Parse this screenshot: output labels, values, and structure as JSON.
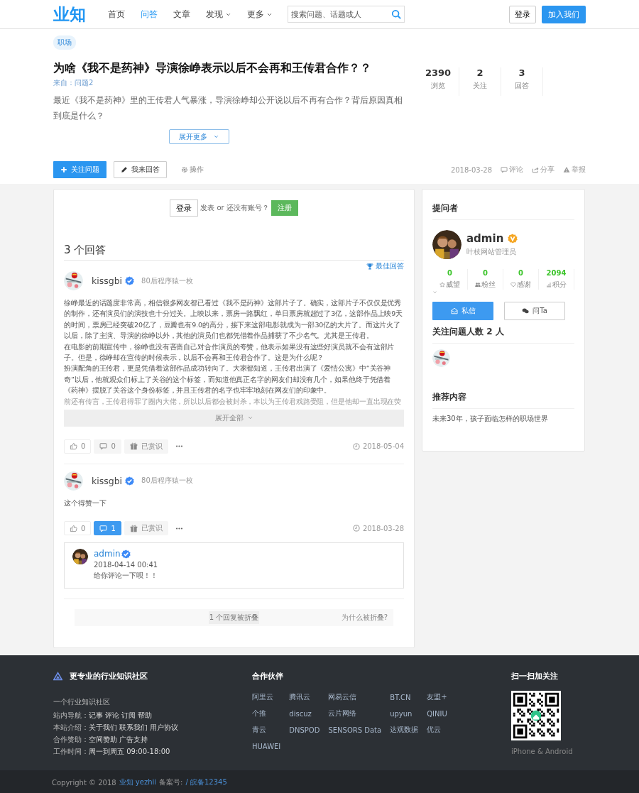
{
  "header": {
    "logo": "业知",
    "nav": [
      {
        "label": "首页",
        "selected": false,
        "dropdown": false
      },
      {
        "label": "问答",
        "selected": true,
        "dropdown": false
      },
      {
        "label": "文章",
        "selected": false,
        "dropdown": false
      },
      {
        "label": "发现",
        "selected": false,
        "dropdown": true
      },
      {
        "label": "更多",
        "selected": false,
        "dropdown": true
      }
    ],
    "search": {
      "placeholder": "搜索问题、话题或人"
    },
    "login": "登录",
    "join": "加入我们"
  },
  "question": {
    "tag": "职场",
    "title": "为啥《我不是药神》导演徐峥表示以后不会再和王传君合作？？",
    "source": "来自：问题2",
    "description": "最近《我不是药神》里的王传君人气暴涨，导演徐峥却公开说以后不再有合作？背后原因真相到底是什么？",
    "expand": "展开更多",
    "stats": [
      {
        "value": "2390",
        "label": "浏览"
      },
      {
        "value": "2",
        "label": "关注"
      },
      {
        "value": "3",
        "label": "回答"
      }
    ],
    "follow_button": "关注问题",
    "answer_button": "我来回答",
    "operate": "操作",
    "date": "2018-03-28",
    "comment": "评论",
    "share": "分享",
    "report": "举报"
  },
  "main": {
    "login_prompt": {
      "login": "登录",
      "text": "发表 or 还没有账号？",
      "register": "注册"
    },
    "answers_title": "3 个回答",
    "best_label": "最佳回答",
    "answers": [
      {
        "author": "kissgbi",
        "verified": true,
        "bio": "80后程序猿一枚",
        "paragraphs": [
          "徐峥最近的话题度非常高，相信很多网友都已看过《我不是药神》这部片子了。确实，这部片子不仅仅是优秀的制作，还有演员们的演技也十分过关。上映以来，票房一路飘红，单日票房就超过了3亿，这部作品上映9天的时间，票房已经突破20亿了，豆瓣也有9.0的高分，接下来这部电影就成为一部30亿的大片了。而这片火了以后，除了主演、导演的徐峥以外，其他的演员们也都凭借着作品捕获了不少名气。尤其是王传君。",
          "在电影的前期宣传中，徐峥也没有吝啬自己对合作演员的夸赞，他表示如果没有这些好演员就不会有这部片子。但是，徐峥却在宣传的时候表示，以后不会再和王传君合作了。这是为什么呢？",
          "扮演配角的王传君，更是凭借着这部作品成功转向了。大家都知道，王传君出演了《爱情公寓》中“关谷神奇”以后，他就观众们标上了关谷的这个标签，而知道他真正名字的网友们却没有几个，如果他终于凭借着《药神》摆脱了关谷这个身份标签，并且王传君的名字也牢牢地刻在网友们的印象中。"
        ],
        "faded_line": "前还有传言，王传君得罪了圈内大佬，所以以后都会被封杀，本以为王传君戏路受阻，但是他却一直出现在荧",
        "expand": "展开全部",
        "likes": "0",
        "comments": "0",
        "comments_open": false,
        "reward": "已赏识",
        "date": "2018-05-04"
      },
      {
        "author": "kissgbi",
        "verified": true,
        "bio": "80后程序猿一枚",
        "paragraphs": [
          "这个得赞一下"
        ],
        "likes": "0",
        "comments": "1",
        "comments_open": true,
        "reward": "已赏识",
        "date": "2018-03-28",
        "replies": [
          {
            "author": "admin",
            "verified": true,
            "date": "2018-04-14 00:41",
            "text": "给你评论一下呗！！"
          }
        ]
      }
    ],
    "collapsed": {
      "text": "1 个回复被折叠",
      "why": "为什么被折叠?"
    }
  },
  "sidebar": {
    "asker_title": "提问者",
    "name": "admin",
    "role": "叶枝网站管理员",
    "stats": [
      {
        "value": "0",
        "label": "威望",
        "kind": "star"
      },
      {
        "value": "0",
        "label": "粉丝",
        "kind": "users"
      },
      {
        "value": "0",
        "label": "感谢",
        "kind": "heart"
      },
      {
        "value": "2094",
        "label": "积分",
        "kind": "chart"
      }
    ],
    "message_button": "私信",
    "ask_button": "问Ta",
    "followers_title": "关注问题人数 2 人",
    "recommend_title": "推荐内容",
    "recommended": [
      "未来30年，孩子面临怎样的职场世界"
    ]
  },
  "footer": {
    "brand": "更专业的行业知识社区",
    "description": "一个行业知识社区",
    "rows": [
      {
        "label": "站内导航：",
        "links": [
          "记事",
          "评论",
          "订阅",
          "帮助"
        ]
      },
      {
        "label": "本站介绍：",
        "links": [
          "关于我们",
          "联系我们",
          "用户协议"
        ]
      },
      {
        "label": "合作赞助：",
        "links": [
          "空间赞助",
          "广告支持"
        ]
      },
      {
        "label": "工作时间：",
        "links": [
          "周一到周五 09:00-18:00"
        ]
      }
    ],
    "partners_title": "合作伙伴",
    "partners": [
      "阿里云",
      "腾讯云",
      "网易云信",
      "BT.CN",
      "友盟+",
      "个推",
      "discuz",
      "云片网络",
      "upyun",
      "QINIU",
      "青云",
      "DNSPOD",
      "SENSORS Data",
      "达观数据",
      "优云",
      "HUAWEI"
    ],
    "qr_title": "扫一扫加关注",
    "qr_caption": "iPhone & Android",
    "copyright": "Copyright © 2018",
    "site_link": "业知 yezhii",
    "icp_label": "备案号:",
    "icp_link": "/ 皖备12345"
  }
}
